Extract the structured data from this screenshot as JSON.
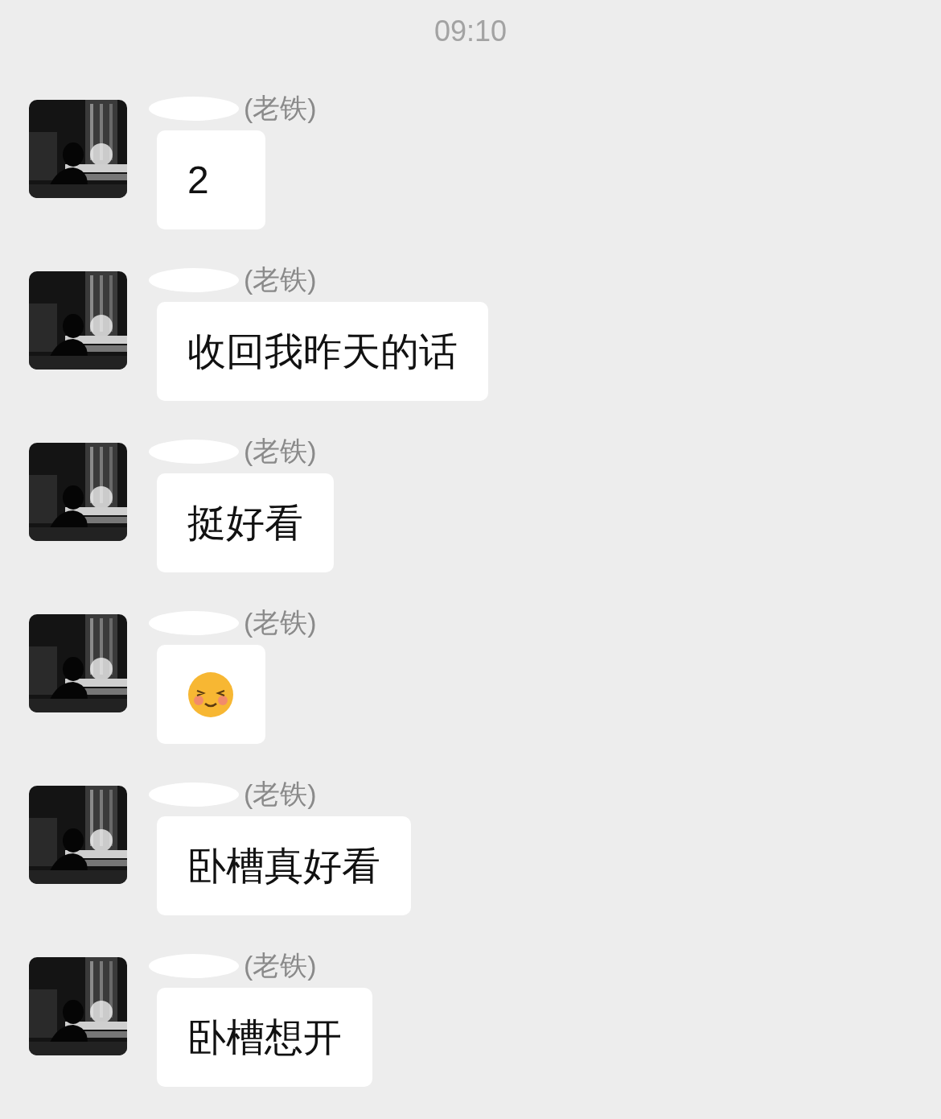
{
  "time": "09:10",
  "messages": [
    {
      "sender": "(老铁)",
      "kind": "text",
      "text": "2"
    },
    {
      "sender": "(老铁)",
      "kind": "text",
      "text": "收回我昨天的话"
    },
    {
      "sender": "(老铁)",
      "kind": "text",
      "text": "挺好看"
    },
    {
      "sender": "(老铁)",
      "kind": "emoji"
    },
    {
      "sender": "(老铁)",
      "kind": "text",
      "text": "卧槽真好看"
    },
    {
      "sender": "(老铁)",
      "kind": "text",
      "text": "卧槽想开"
    }
  ]
}
